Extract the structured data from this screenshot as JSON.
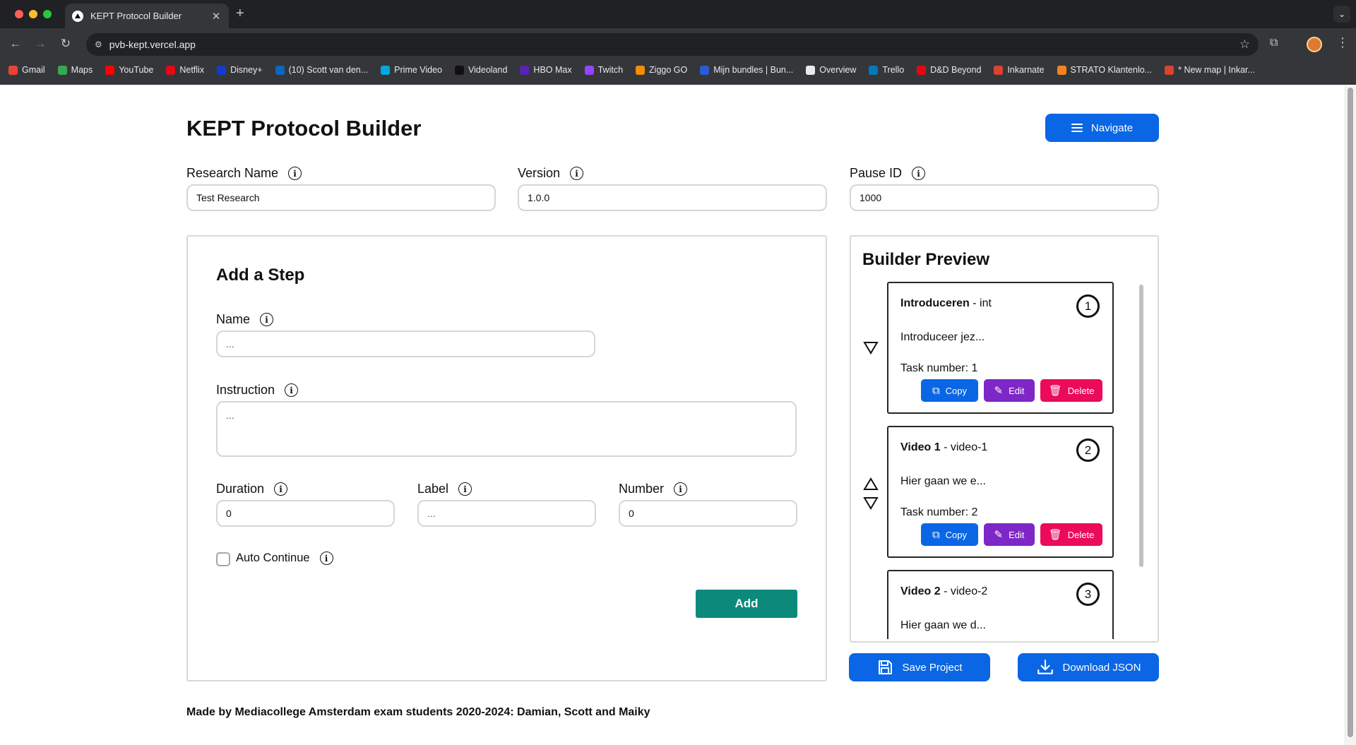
{
  "browser": {
    "tab_title": "KEPT Protocol Builder",
    "url": "pvb-kept.vercel.app",
    "bookmarks": [
      {
        "label": "Gmail",
        "color": "#ea4335"
      },
      {
        "label": "Maps",
        "color": "#34a853"
      },
      {
        "label": "YouTube",
        "color": "#ff0000"
      },
      {
        "label": "Netflix",
        "color": "#e50914"
      },
      {
        "label": "Disney+",
        "color": "#113ccf"
      },
      {
        "label": "(10) Scott van den...",
        "color": "#0a66c2"
      },
      {
        "label": "Prime Video",
        "color": "#00a8e1"
      },
      {
        "label": "Videoland",
        "color": "#111111"
      },
      {
        "label": "HBO Max",
        "color": "#5822b4"
      },
      {
        "label": "Twitch",
        "color": "#9146ff"
      },
      {
        "label": "Ziggo GO",
        "color": "#f48c00"
      },
      {
        "label": "Mijn bundles | Bun...",
        "color": "#2a5bd7"
      },
      {
        "label": "Overview",
        "color": "#e8eaed"
      },
      {
        "label": "Trello",
        "color": "#0079bf"
      },
      {
        "label": "D&D Beyond",
        "color": "#e40712"
      },
      {
        "label": "Inkarnate",
        "color": "#d9432f"
      },
      {
        "label": "STRATO Klantenlo...",
        "color": "#f58220"
      },
      {
        "label": "* New map | Inkar...",
        "color": "#d9432f"
      }
    ]
  },
  "header": {
    "title": "KEPT Protocol Builder",
    "navigate_label": "Navigate"
  },
  "meta_fields": {
    "research_name": {
      "label": "Research Name",
      "value": "Test Research"
    },
    "version": {
      "label": "Version",
      "value": "1.0.0"
    },
    "pause_id": {
      "label": "Pause ID",
      "value": "1000"
    }
  },
  "add_step": {
    "title": "Add a Step",
    "name": {
      "label": "Name",
      "placeholder": "..."
    },
    "instruction": {
      "label": "Instruction",
      "placeholder": "..."
    },
    "duration": {
      "label": "Duration",
      "value": "0"
    },
    "label": {
      "label": "Label",
      "placeholder": "..."
    },
    "number": {
      "label": "Number",
      "value": "0"
    },
    "auto_continue": {
      "label": "Auto Continue",
      "checked": false
    },
    "add_label": "Add"
  },
  "preview": {
    "title": "Builder Preview",
    "steps": [
      {
        "name": "Introduceren",
        "label": " - int",
        "number": "1",
        "instruction": "Introduceer jez...",
        "task": "Task number: 1"
      },
      {
        "name": "Video 1",
        "label": " - video-1",
        "number": "2",
        "instruction": "Hier gaan we e...",
        "task": "Task number: 2"
      },
      {
        "name": "Video 2",
        "label": " - video-2",
        "number": "3",
        "instruction": "Hier gaan we d...",
        "task": ""
      }
    ],
    "actions": {
      "copy": "Copy",
      "edit": "Edit",
      "delete": "Delete"
    },
    "save_label": "Save Project",
    "download_label": "Download JSON"
  },
  "footer": {
    "text": "Made by Mediacollege Amsterdam exam students 2020-2024: Damian, Scott and Maiky"
  }
}
